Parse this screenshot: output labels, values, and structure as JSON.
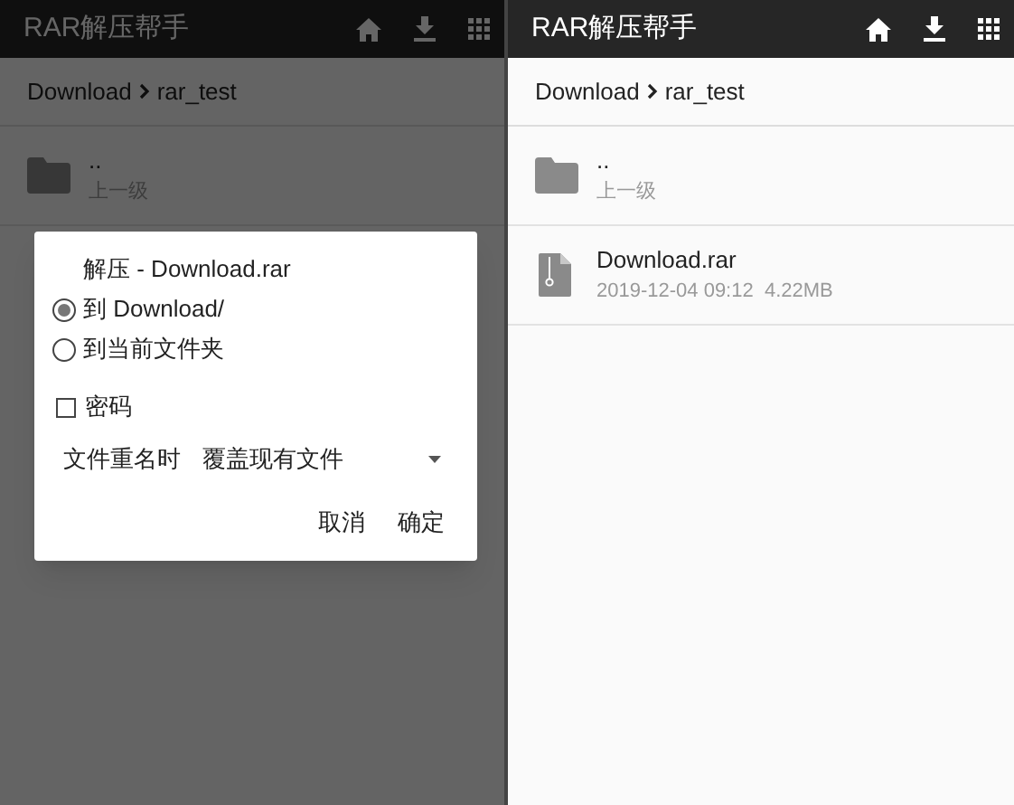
{
  "screens": [
    {
      "app_bar": {
        "title": "RAR解压帮手"
      },
      "breadcrumb": [
        "Download",
        "rar_test"
      ],
      "items": [
        {
          "kind": "folder",
          "name": "..",
          "detail": "上一级"
        }
      ],
      "dialog": {
        "title": "解压 - Download.rar",
        "options": [
          {
            "label": "到 Download/",
            "selected": true
          },
          {
            "label": "到当前文件夹",
            "selected": false
          }
        ],
        "password": {
          "label": "密码",
          "checked": false
        },
        "conflict": {
          "label": "文件重名时",
          "value": "覆盖现有文件"
        },
        "buttons": [
          "取消",
          "确定"
        ]
      }
    },
    {
      "app_bar": {
        "title": "RAR解压帮手"
      },
      "breadcrumb": [
        "Download",
        "rar_test"
      ],
      "items": [
        {
          "kind": "folder",
          "name": "..",
          "detail": "上一级"
        },
        {
          "kind": "archive",
          "name": "Download.rar",
          "detail": "2019-12-04 09:12  4.22MB"
        }
      ]
    }
  ]
}
